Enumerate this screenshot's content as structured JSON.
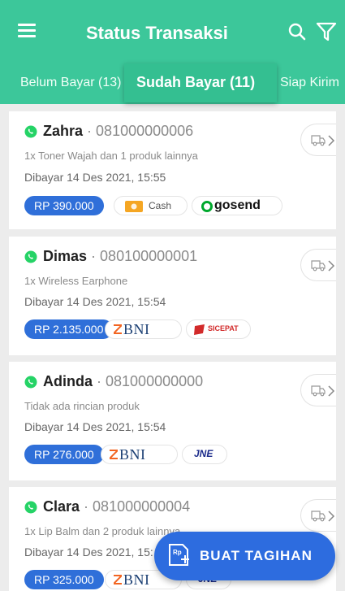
{
  "header": {
    "title": "Status Transaksi",
    "background": "#3cc79a"
  },
  "tabs": [
    {
      "label": "Belum Bayar (13)",
      "active": false
    },
    {
      "label": "Sudah Bayar (11)",
      "active": true
    },
    {
      "label": "Siap Kirim",
      "active": false
    }
  ],
  "transactions": [
    {
      "name": "Zahra",
      "phone": "· 081000000006",
      "items": "1x Toner Wajah dan 1 produk lainnya",
      "paid": "Dibayar 14 Des 2021, 15:55",
      "amount": "RP 390.000",
      "payment": "Cash",
      "courier": "gosend"
    },
    {
      "name": "Dimas",
      "phone": "· 080100000001",
      "items": "1x Wireless Earphone",
      "paid": "Dibayar 14 Des 2021, 15:54",
      "amount": "RP 2.135.000",
      "payment": "BNI",
      "courier": "SICEPAT"
    },
    {
      "name": "Adinda",
      "phone": "· 081000000000",
      "items": "Tidak ada rincian produk",
      "paid": "Dibayar 14 Des 2021, 15:54",
      "amount": "RP 276.000",
      "payment": "BNI",
      "courier": "JNE"
    },
    {
      "name": "Clara",
      "phone": "· 081000000004",
      "items": "1x Lip Balm dan 2 produk lainnya",
      "paid": "Dibayar 14 Des 2021, 15:",
      "amount": "RP 325.000",
      "payment": "BNI",
      "courier": "JNE"
    }
  ],
  "fab": {
    "label": "BUAT TAGIHAN",
    "icon": "invoice-icon",
    "icon_text": "Rp"
  },
  "colors": {
    "accent": "#3cc79a",
    "primary_blue": "#2d6cdf",
    "whatsapp": "#25d366"
  }
}
